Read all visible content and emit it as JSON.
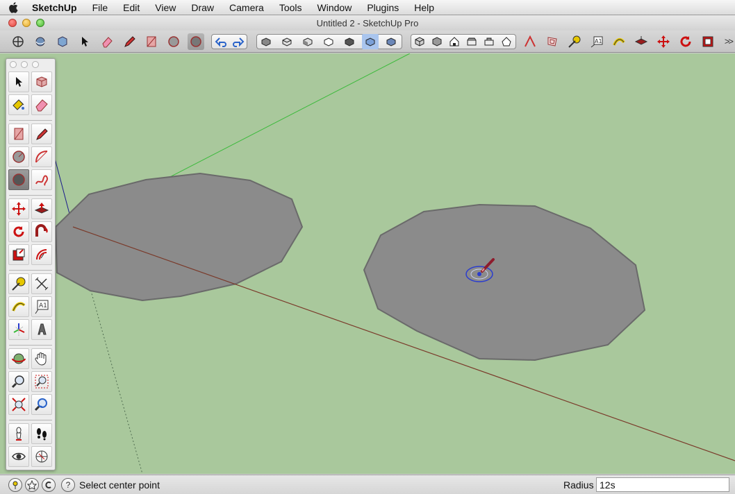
{
  "menubar": {
    "app_name": "SketchUp",
    "items": [
      "File",
      "Edit",
      "View",
      "Draw",
      "Camera",
      "Tools",
      "Window",
      "Plugins",
      "Help"
    ]
  },
  "window": {
    "title": "Untitled 2 - SketchUp Pro"
  },
  "toolbar": {
    "icons": [
      "select-cursor-icon",
      "orbit-icon",
      "component-icon",
      "arrow-icon",
      "eraser-icon",
      "pencil-icon",
      "rectangle-icon",
      "circle-icon",
      "polygon-icon",
      "undo-icon",
      "redo-icon",
      "iso-view-icon",
      "top-view-icon",
      "front-view-icon",
      "right-view-icon",
      "back-view-icon",
      "left-view-icon",
      "bottom-view-icon",
      "xray-icon",
      "wireframe-icon",
      "hidden-line-icon",
      "shaded-icon",
      "shaded-texture-icon",
      "monochrome-icon",
      "arc-icon",
      "offset-icon",
      "tape-measure-icon",
      "dimension-icon",
      "text-icon",
      "paint-icon",
      "push-pull-icon",
      "move-icon",
      "rotate-icon",
      "scale-icon"
    ],
    "more_label": ">>"
  },
  "palette": {
    "tools": [
      "select-tool",
      "make-component-tool",
      "paint-bucket-tool",
      "eraser-tool",
      "rectangle-tool",
      "line-tool",
      "circle-tool",
      "arc-tool",
      "polygon-tool",
      "freehand-tool",
      "move-tool",
      "push-pull-tool",
      "rotate-tool",
      "follow-me-tool",
      "scale-tool",
      "offset-tool",
      "tape-measure-tool",
      "dimension-tool",
      "protractor-tool",
      "text-tool",
      "axes-tool",
      "3d-text-tool",
      "orbit-tool",
      "pan-tool",
      "zoom-tool",
      "zoom-window-tool",
      "zoom-extents-tool",
      "previous-view-tool",
      "position-camera-tool",
      "walk-tool",
      "look-around-tool",
      "section-plane-tool"
    ],
    "active_tool": "polygon-tool",
    "text_tool_label": "A1"
  },
  "statusbar": {
    "status_text": "Select center point",
    "measurement_label": "Radius",
    "measurement_value": "12s",
    "help_icon": "?"
  },
  "colors": {
    "viewport_bg": "#a9c89c",
    "polygon_fill": "#8b8b8b",
    "polygon_edge": "#6a6a6a",
    "red_axis": "#7a3a2a",
    "green_axis": "#3cba3c",
    "blue_axis": "#1a1a8c"
  }
}
